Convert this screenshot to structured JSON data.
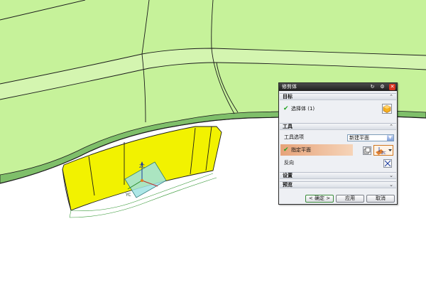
{
  "dialog": {
    "title": "修剪体",
    "title_icons": [
      "refresh-icon",
      "gear-icon",
      "close-icon"
    ],
    "target_section": {
      "label": "目标",
      "select_body_label": "选择体 (1)"
    },
    "tool_section": {
      "label": "工具",
      "tool_option_label": "工具选项",
      "tool_option_value": "新建平面",
      "specify_plane_label": "指定平面"
    },
    "reverse_label": "反向",
    "settings_label": "设置",
    "preview_label": "预览",
    "buttons": {
      "ok": "< 确定 >",
      "apply": "应用",
      "cancel": "取消"
    }
  },
  "viewport": {
    "axis_labels": {
      "z": "ZC",
      "y": "YC",
      "handle": "ZC"
    }
  },
  "colors": {
    "model_face": "#c6f29a",
    "model_edge": "#1a1a1a",
    "selected_body": "#f2f200",
    "plane": "#9fe3e3",
    "highlight_row": "#e6a37a"
  }
}
